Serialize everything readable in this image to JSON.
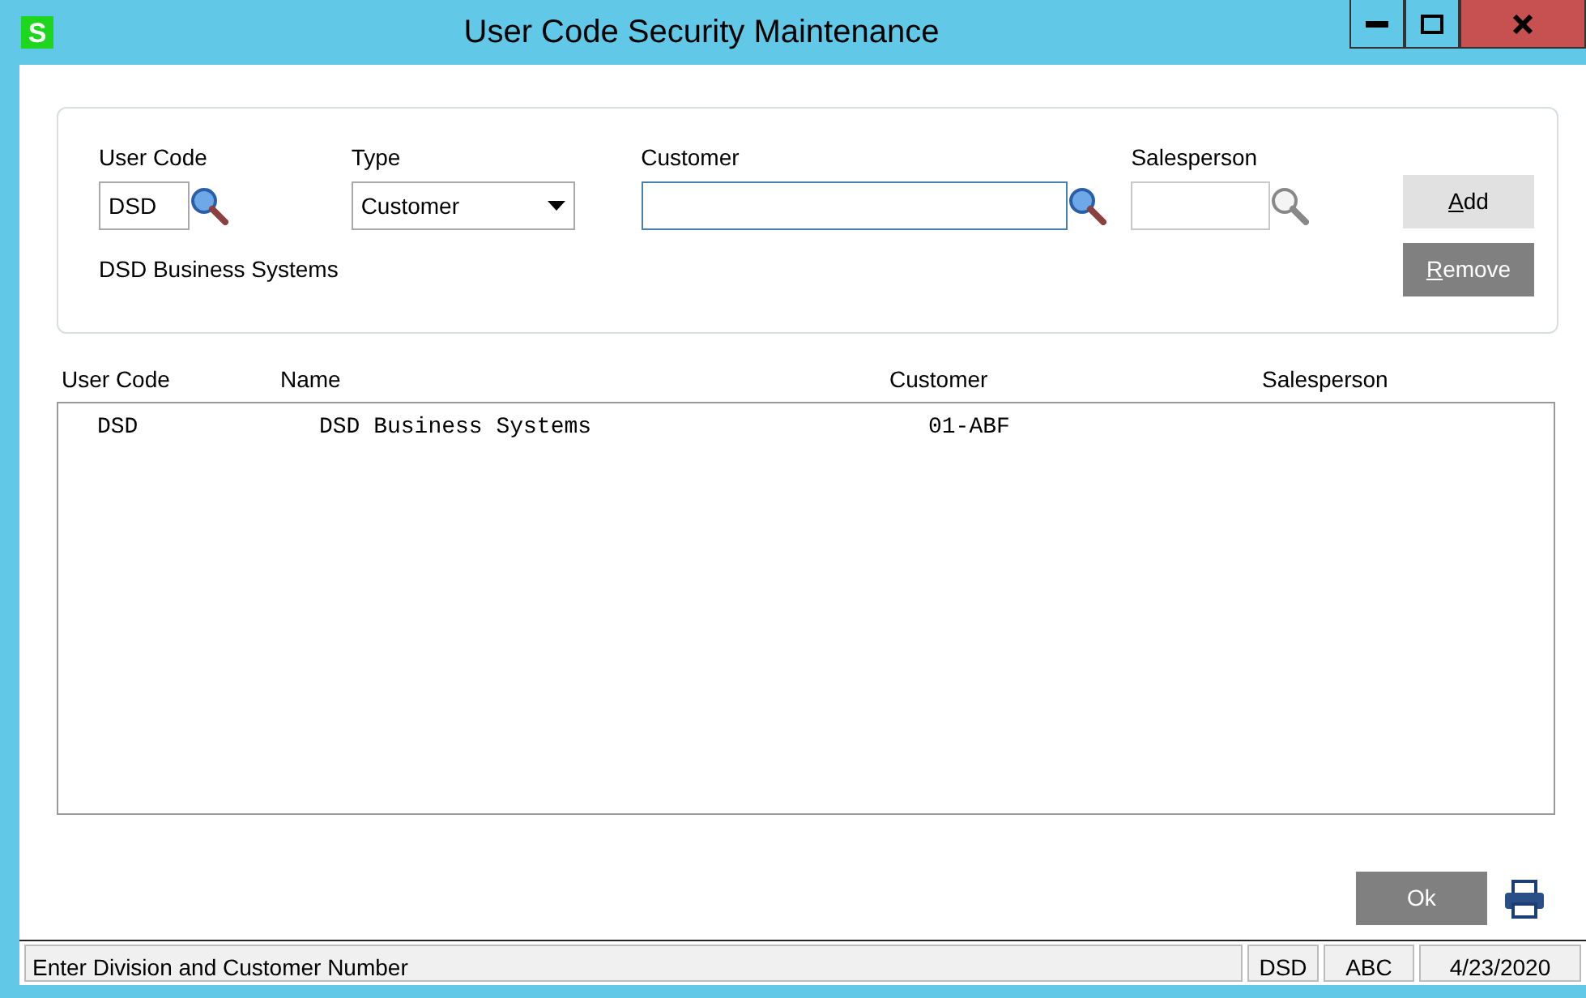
{
  "window": {
    "title": "User Code Security Maintenance",
    "app_icon": "S"
  },
  "form": {
    "user_code": {
      "label": "User Code",
      "value": "DSD"
    },
    "type": {
      "label": "Type",
      "value": "Customer"
    },
    "customer": {
      "label": "Customer",
      "focused": true
    },
    "salesperson": {
      "label": "Salesperson",
      "disabled": true
    },
    "description": "DSD Business Systems",
    "buttons": [
      {
        "label": "Add",
        "disabled": false
      },
      {
        "label": "Remove",
        "disabled": true
      }
    ]
  },
  "table": {
    "columns": [
      "User Code",
      "Name",
      "Customer",
      "Salesperson"
    ],
    "rows": [
      [
        "DSD",
        "DSD Business Systems",
        "01-ABF"
      ]
    ]
  },
  "ok_button": {
    "label": "Ok",
    "disabled": true
  },
  "status_bar": [
    "Enter Division and Customer Number",
    "DSD",
    "ABC",
    "4/23/2020"
  ]
}
